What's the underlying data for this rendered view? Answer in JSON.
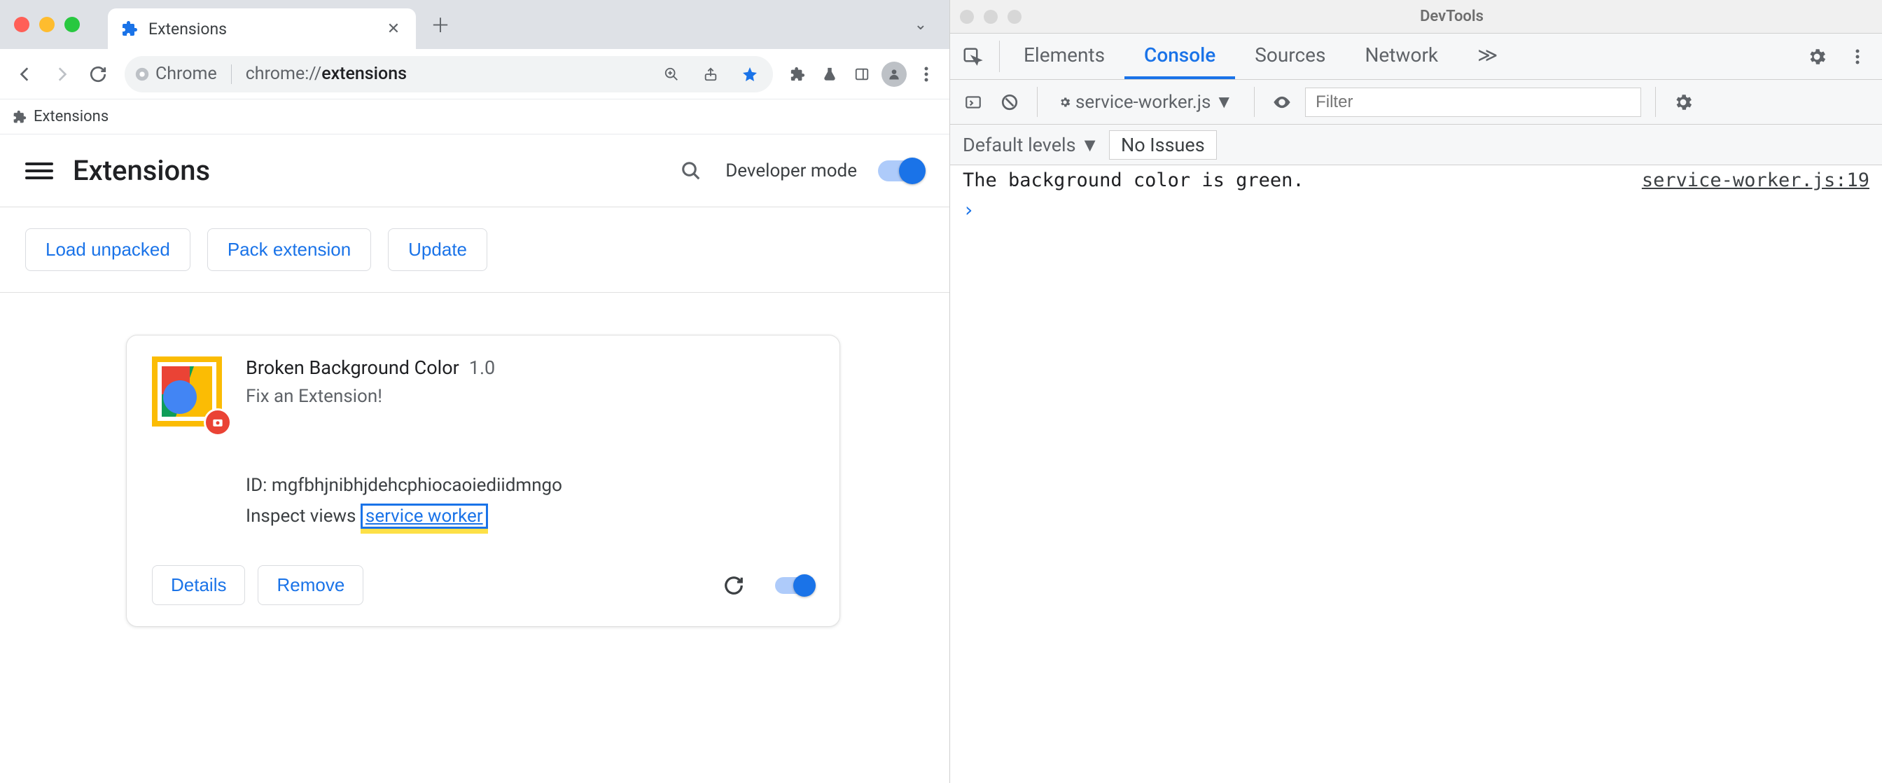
{
  "chrome": {
    "tab": {
      "title": "Extensions",
      "close_glyph": "✕"
    },
    "new_tab_glyph": "＋",
    "overflow_glyph": "⌄",
    "omnibox": {
      "chip_label": "Chrome",
      "url_prefix": "chrome://",
      "url_bold": "extensions"
    },
    "bookmark_bar": {
      "item1": "Extensions"
    }
  },
  "extensions_page": {
    "title": "Extensions",
    "developer_mode_label": "Developer mode",
    "dev_actions": {
      "load_unpacked": "Load unpacked",
      "pack_extension": "Pack extension",
      "update": "Update"
    },
    "card": {
      "name": "Broken Background Color",
      "version": "1.0",
      "description": "Fix an Extension!",
      "id_label": "ID:",
      "id_value": "mgfbhjnibhjdehcphiocaoiediidmngo",
      "inspect_label": "Inspect views",
      "inspect_link": "service worker",
      "details_btn": "Details",
      "remove_btn": "Remove"
    }
  },
  "devtools": {
    "title": "DevTools",
    "tabs": {
      "elements": "Elements",
      "console": "Console",
      "sources": "Sources",
      "network": "Network",
      "overflow": "≫"
    },
    "toolbar": {
      "context": "service-worker.js",
      "filter_placeholder": "Filter"
    },
    "levels": "Default levels",
    "no_issues": "No Issues",
    "console_rows": [
      {
        "msg": "The background color is green.",
        "src": "service-worker.js:19"
      }
    ],
    "prompt_glyph": "›"
  }
}
